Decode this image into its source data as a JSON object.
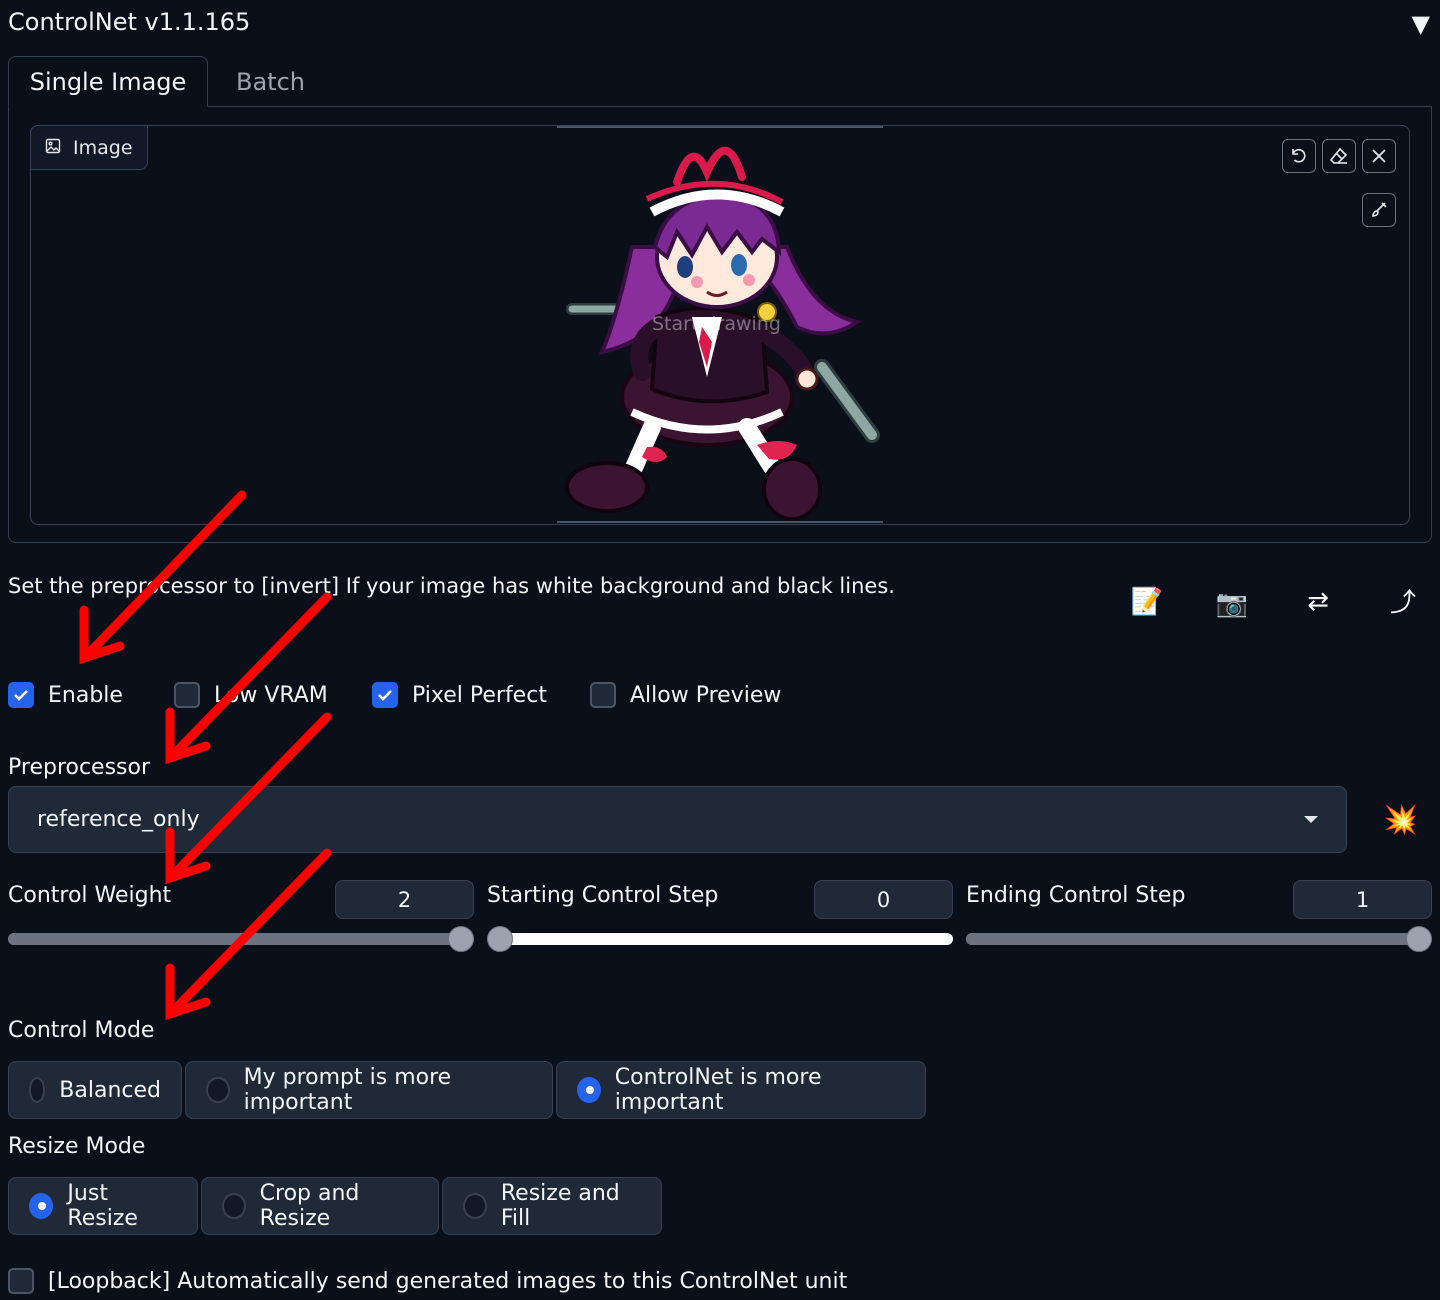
{
  "header": {
    "title": "ControlNet v1.1.165",
    "collapse_icon": "▼"
  },
  "tabs": [
    {
      "label": "Single Image",
      "active": true
    },
    {
      "label": "Batch",
      "active": false
    }
  ],
  "image_panel": {
    "label": "Image",
    "canvas_placeholder": "Start drawing",
    "tools": [
      "undo-icon",
      "eraser-icon",
      "close-icon",
      "brush-icon"
    ]
  },
  "hint_text": "Set the preprocessor to [invert] If your image has white background and black lines.",
  "action_icons": [
    {
      "name": "new-canvas-icon",
      "glyph": "📝"
    },
    {
      "name": "camera-icon",
      "glyph": "📷"
    },
    {
      "name": "swap-dimensions-icon",
      "glyph": "⇄"
    },
    {
      "name": "send-dimensions-icon",
      "glyph": "⤴"
    }
  ],
  "checkboxes": [
    {
      "label": "Enable",
      "checked": true
    },
    {
      "label": "Low VRAM",
      "checked": false
    },
    {
      "label": "Pixel Perfect",
      "checked": true
    },
    {
      "label": "Allow Preview",
      "checked": false
    }
  ],
  "preprocessor": {
    "label": "Preprocessor",
    "value": "reference_only",
    "run_icon": "💥"
  },
  "sliders": [
    {
      "label": "Control Weight",
      "value": "2",
      "min": 0,
      "max": 2,
      "fraction": 1.0
    },
    {
      "label": "Starting Control Step",
      "value": "0",
      "min": 0,
      "max": 1,
      "fraction": 0.0
    },
    {
      "label": "Ending Control Step",
      "value": "1",
      "min": 0,
      "max": 1,
      "fraction": 1.0
    }
  ],
  "control_mode": {
    "label": "Control Mode",
    "options": [
      "Balanced",
      "My prompt is more important",
      "ControlNet is more important"
    ],
    "selected": "ControlNet is more important"
  },
  "resize_mode": {
    "label": "Resize Mode",
    "options": [
      "Just Resize",
      "Crop and Resize",
      "Resize and Fill"
    ],
    "selected": "Just Resize"
  },
  "loopback": {
    "label": "[Loopback] Automatically send generated images to this ControlNet unit",
    "checked": false
  },
  "colors": {
    "background": "#0b0f19",
    "accent": "#2563eb",
    "annotation_arrow": "#ff0000"
  }
}
